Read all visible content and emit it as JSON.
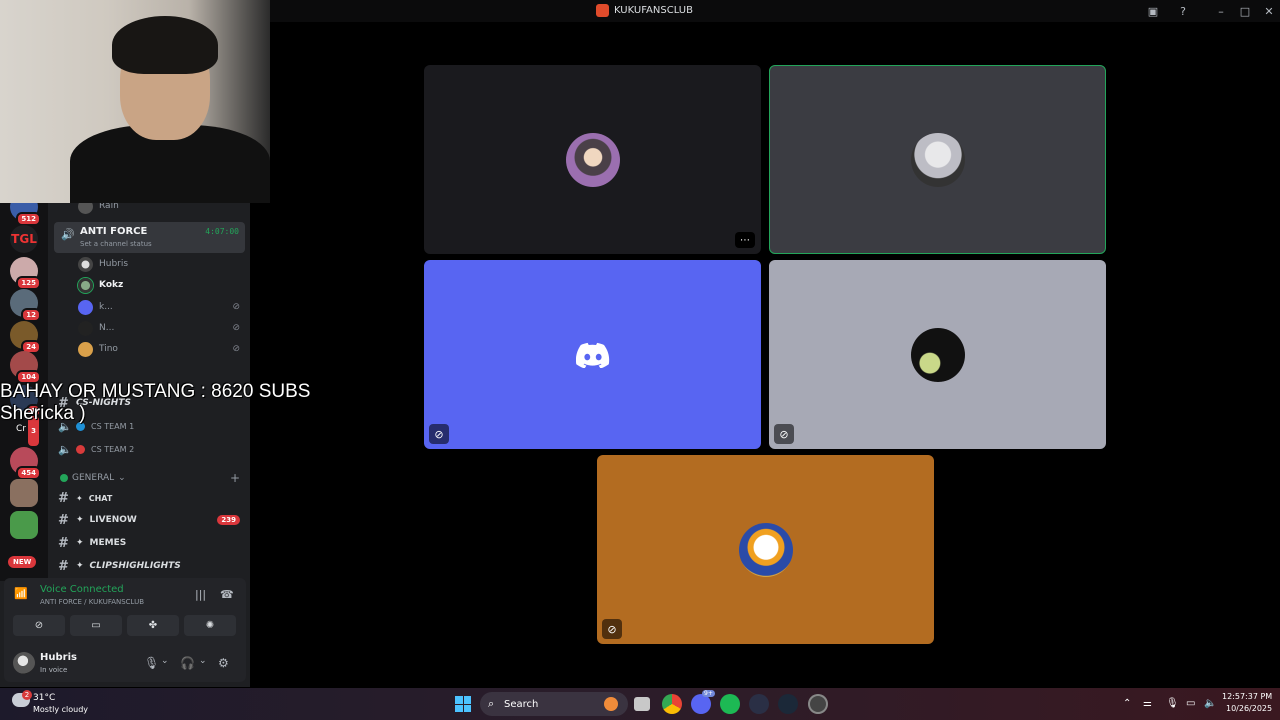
{
  "window": {
    "title": "KUKUFANSCLUB"
  },
  "overlay": {
    "line1": "BAHAY OR MUSTANG : 8620 SUBS",
    "line2": "Shericka )"
  },
  "guild_badges": [
    "512",
    "125",
    "12",
    "24",
    "104",
    "1",
    "3",
    "454"
  ],
  "guild_labels": {
    "crk": "CrK",
    "new": "NEW"
  },
  "sidebar": {
    "prev_member": "Rain",
    "active_channel": {
      "name": "ANTI FORCE",
      "timer": "4:07:00",
      "status": "Set a channel status"
    },
    "members": [
      "Hubris",
      "Kokz",
      "k...",
      "N...",
      "Tino"
    ],
    "cs_category": "CS-NIGHTS",
    "cs_channels": [
      "CS TEAM 1",
      "CS TEAM 2"
    ],
    "general_category": "GENERAL",
    "text_channels": [
      {
        "name": "CHAT"
      },
      {
        "name": "LIVENOW",
        "badge": "239"
      },
      {
        "name": "MEMES"
      },
      {
        "name": "CLIPSHIGHLIGHTS"
      }
    ]
  },
  "voice_panel": {
    "title": "Voice Connected",
    "subtitle": "ANTI FORCE / KUKUFANSCLUB"
  },
  "user": {
    "name": "Hubris",
    "status": "In voice"
  },
  "taskbar": {
    "weather_temp": "31°C",
    "weather_desc": "Mostly cloudy",
    "weather_badge": "2",
    "search": "Search",
    "time": "12:57:37 PM",
    "date": "10/26/2025",
    "discord_badge": "9+"
  },
  "colors": {
    "discord_blurple": "#5865f2",
    "tile_dark": "#1a1a1e",
    "tile_grey_speaking": "#3b3c42",
    "tile_light_grey": "#a7a9b5",
    "tile_orange": "#b36c21",
    "speaking_green": "#23a55a"
  }
}
